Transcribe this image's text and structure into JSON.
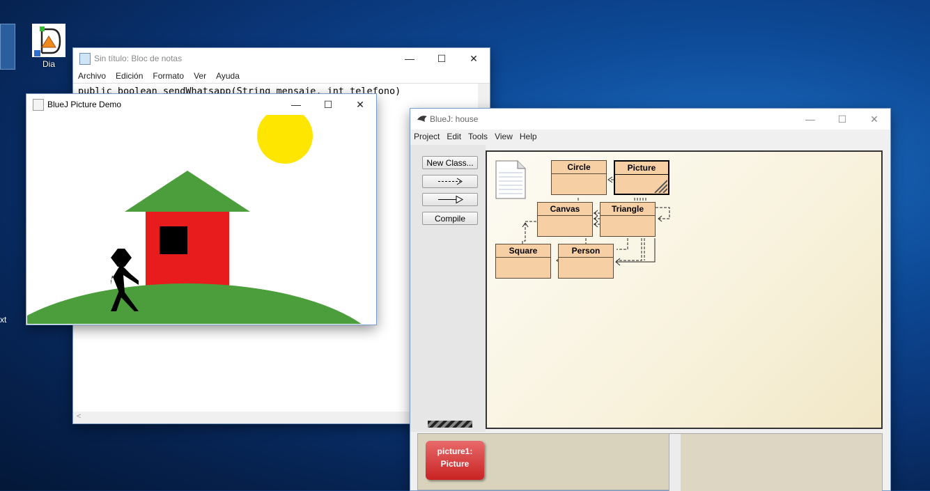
{
  "desktop": {
    "icon_label": "Dia",
    "edge_text": "xt"
  },
  "notepad": {
    "title": "Sin título: Bloc de notas",
    "menu": [
      "Archivo",
      "Edición",
      "Formato",
      "Ver",
      "Ayuda"
    ],
    "content": "public boolean sendWhatsapp(String mensaje, int telefono)"
  },
  "picture_demo": {
    "title": "BlueJ Picture Demo",
    "colors": {
      "sun": "#ffe600",
      "roof": "#4c9e3c",
      "wall": "#e81c1c",
      "window": "#000000",
      "hill": "#4c9e3c",
      "person": "#000000"
    }
  },
  "bluej": {
    "title": "BlueJ:  house",
    "menu": [
      "Project",
      "Edit",
      "Tools",
      "View",
      "Help"
    ],
    "buttons": {
      "new_class": "New Class...",
      "uses_arrow": "- - ->",
      "inherit_arrow": "——▷",
      "compile": "Compile"
    },
    "classes": [
      "Circle",
      "Picture",
      "Canvas",
      "Triangle",
      "Square",
      "Person"
    ],
    "object_bench": {
      "object_name": "picture1:",
      "object_type": "Picture"
    }
  }
}
